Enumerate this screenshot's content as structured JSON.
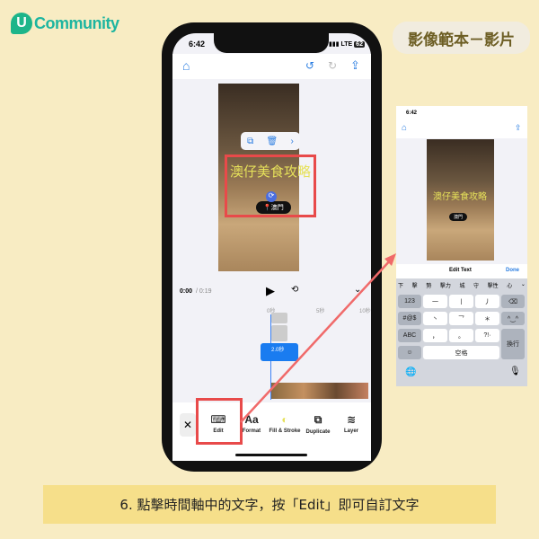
{
  "brand": {
    "logo_letter": "U",
    "logo_text": "Community"
  },
  "badge": "影像範本－影片",
  "phone": {
    "status_time": "6:42",
    "network": "LTE",
    "battery": "62",
    "overlay_text": "澳仔美食攻略",
    "location_tag": "澳門",
    "time_current": "0:00",
    "time_total": "/ 0:19",
    "ruler": [
      "0秒",
      "5秒",
      "10秒"
    ],
    "clip_duration": "2.0秒",
    "tools": [
      {
        "icon": "keyboard-icon",
        "label": "Edit"
      },
      {
        "icon": "format-icon",
        "label": "Format"
      },
      {
        "icon": "fill-stroke-icon",
        "label": "Fill & Stroke"
      },
      {
        "icon": "duplicate-icon",
        "label": "Duplicate"
      },
      {
        "icon": "layer-icon",
        "label": "Layer"
      }
    ]
  },
  "detail": {
    "status_time": "6:42",
    "overlay_text": "澳仔美食攻略",
    "location_tag": "澳門",
    "edit_title": "Edit Text",
    "done": "Done",
    "suggestions": [
      "下",
      "擊",
      "勢",
      "擊力",
      "城",
      "守",
      "擊性",
      "心"
    ],
    "keys": {
      "num": "123",
      "sym": "#@$",
      "abc": "ABC",
      "space": "空格",
      "return": "換行",
      "row1": [
        "一",
        "丨",
        "丿"
      ],
      "row2": [
        "丶",
        "乛",
        "＊"
      ],
      "row3": [
        "，",
        "。",
        "?!·"
      ]
    }
  },
  "caption": "6. 點擊時間軸中的文字，按「Edit」即可自訂文字",
  "colors": {
    "background": "#f8ecc3",
    "accent": "#e84a4a",
    "brand": "#1db58a",
    "ios_blue": "#2a7de1"
  }
}
